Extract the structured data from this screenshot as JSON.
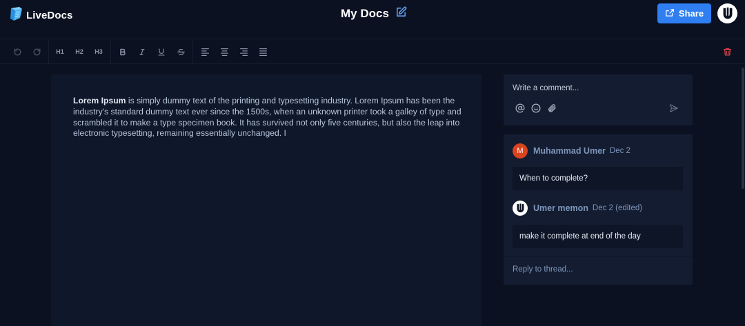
{
  "app": {
    "name": "LiveDocs"
  },
  "document": {
    "title": "My Docs"
  },
  "header": {
    "share_label": "Share"
  },
  "toolbar": {
    "h1": "H1",
    "h2": "H2",
    "h3": "H3"
  },
  "editor": {
    "bold_lead": "Lorem Ipsum",
    "body": " is simply dummy text of the printing and typesetting industry. Lorem Ipsum has been the industry's standard dummy text ever since the 1500s, when an unknown printer took a galley of type and scrambled it to make a type specimen book. It has survived not only five centuries, but also the leap into electronic typesetting, remaining essentially unchanged. I"
  },
  "composer": {
    "placeholder": "Write a comment..."
  },
  "thread": {
    "comments": [
      {
        "initial": "M",
        "author": "Muhammad Umer",
        "date": "Dec 2",
        "text": "When to complete?"
      },
      {
        "author": "Umer memon",
        "date": "Dec 2 (edited)",
        "text": "make it complete at end of the day"
      }
    ],
    "reply_placeholder": "Reply to thread..."
  },
  "colors": {
    "background": "#0b1120",
    "editor_bg": "#0f172a",
    "panel_bg": "#131c31",
    "accent": "#2f7ff2",
    "danger": "#e5484d",
    "avatar_m": "#d9431e"
  }
}
